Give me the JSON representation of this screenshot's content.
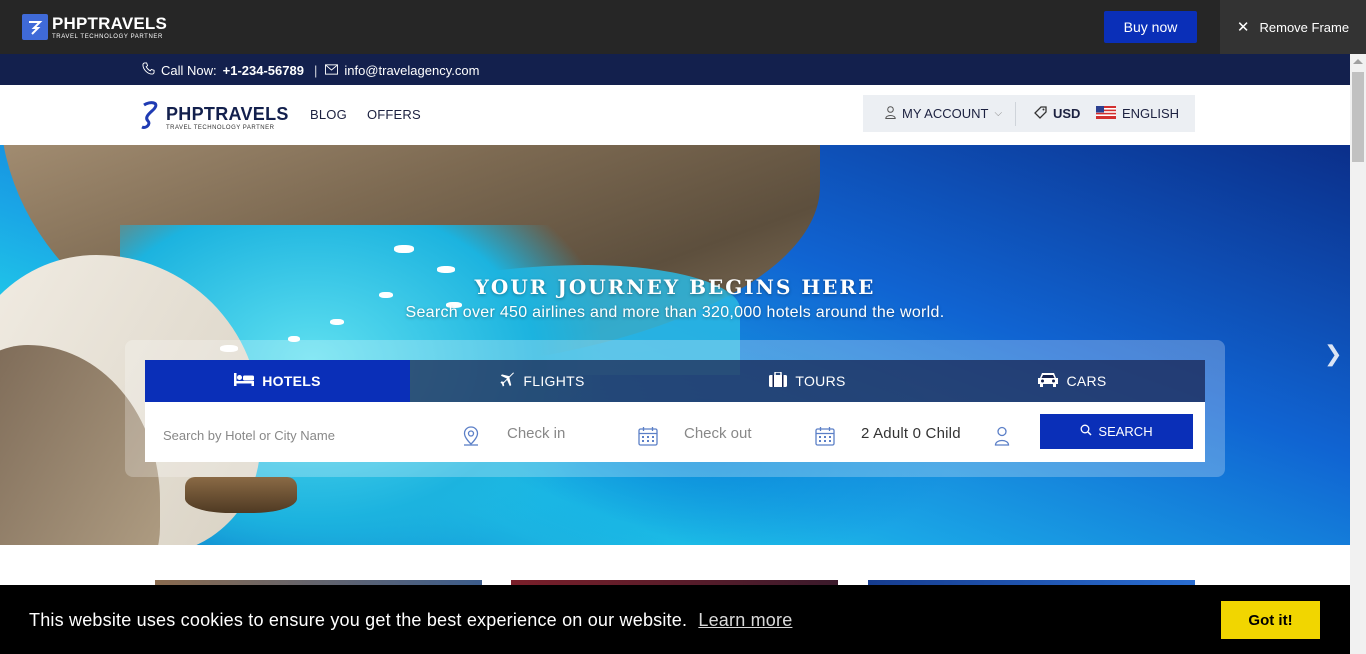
{
  "frame": {
    "logo_name": "PHPTRAVELS",
    "logo_tagline": "TRAVEL TECHNOLOGY PARTNER",
    "buy_now": "Buy now",
    "remove_frame": "Remove Frame"
  },
  "topbar": {
    "call_label": "Call Now:",
    "phone": "+1-234-56789",
    "separator": "|",
    "email": "info@travelagency.com"
  },
  "header": {
    "logo_name": "PHPTRAVELS",
    "logo_tagline": "TRAVEL TECHNOLOGY PARTNER",
    "nav": [
      "BLOG",
      "OFFERS"
    ],
    "account": "MY ACCOUNT",
    "currency": "USD",
    "language": "ENGLISH"
  },
  "hero": {
    "title": "YOUR JOURNEY BEGINS HERE",
    "subtitle": "Search over 450 airlines and more than 320,000 hotels around the world."
  },
  "search": {
    "tabs": [
      "HOTELS",
      "FLIGHTS",
      "TOURS",
      "CARS"
    ],
    "active_tab": "HOTELS",
    "city_placeholder": "Search by Hotel or City Name",
    "checkin_placeholder": "Check in",
    "checkout_placeholder": "Check out",
    "guests": "2 Adult 0 Child",
    "button": "SEARCH"
  },
  "cookie": {
    "message": "This website uses cookies to ensure you get the best experience on our website.",
    "learn_more": "Learn more",
    "accept": "Got it!"
  },
  "colors": {
    "primary": "#0a2fb8",
    "navy": "#13204d",
    "cookie_button": "#f1d600"
  }
}
